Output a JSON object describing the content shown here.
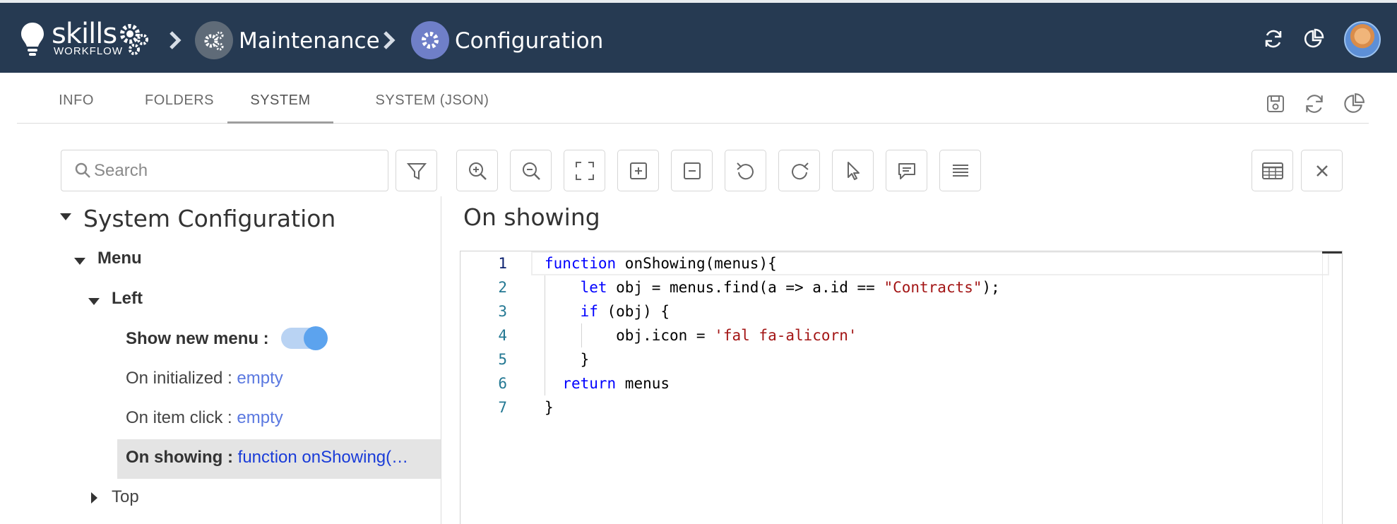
{
  "header": {
    "logo_text": "skills",
    "logo_subtext": "WORKFLOW",
    "breadcrumb": [
      {
        "label": "Maintenance",
        "icon": "gears-icon",
        "color": "#5f6b78"
      },
      {
        "label": "Configuration",
        "icon": "gear-icon",
        "color": "#6f7fc8"
      }
    ],
    "actions": [
      "refresh-icon",
      "pie-chart-icon"
    ],
    "background": "#263a52"
  },
  "tabs": [
    {
      "label": "INFO",
      "active": false
    },
    {
      "label": "FOLDERS",
      "active": false
    },
    {
      "label": "SYSTEM",
      "active": true
    },
    {
      "label": "SYSTEM (JSON)",
      "active": false
    }
  ],
  "tab_tools": [
    "save-icon",
    "refresh-icon",
    "pie-chart-icon"
  ],
  "search": {
    "placeholder": "Search",
    "value": ""
  },
  "toolbar": [
    "filter-icon",
    "zoom-in-icon",
    "zoom-out-icon",
    "fit-screen-icon",
    "expand-icon",
    "collapse-icon",
    "undo-icon",
    "redo-icon",
    "pointer-icon",
    "comment-icon",
    "list-icon",
    "table-icon",
    "close-icon"
  ],
  "tree": {
    "root": "System Configuration",
    "menu": "Menu",
    "left": "Left",
    "props": [
      {
        "label": "Show new menu :",
        "toggle": true
      },
      {
        "label": "On initialized :",
        "value": "empty"
      },
      {
        "label": "On item click :",
        "value": "empty"
      },
      {
        "label": "On showing :",
        "value": "function onShowing(…",
        "selected": true
      }
    ],
    "top": "Top"
  },
  "editor": {
    "title": "On showing",
    "line_numbers": [
      "1",
      "2",
      "3",
      "4",
      "5",
      "6",
      "7"
    ],
    "lines": [
      [
        {
          "t": "function",
          "c": "kw"
        },
        {
          "t": " onShowing(menus){",
          "c": ""
        }
      ],
      [
        {
          "t": "    ",
          "c": ""
        },
        {
          "t": "let",
          "c": "kw"
        },
        {
          "t": " obj = menus.find(a => a.id == ",
          "c": ""
        },
        {
          "t": "\"Contracts\"",
          "c": "str"
        },
        {
          "t": ");",
          "c": ""
        }
      ],
      [
        {
          "t": "    ",
          "c": ""
        },
        {
          "t": "if",
          "c": "kw"
        },
        {
          "t": " (obj) {",
          "c": ""
        }
      ],
      [
        {
          "t": "        obj.icon = ",
          "c": ""
        },
        {
          "t": "'fal fa-alicorn'",
          "c": "str"
        }
      ],
      [
        {
          "t": "    }",
          "c": ""
        }
      ],
      [
        {
          "t": "  ",
          "c": ""
        },
        {
          "t": "return",
          "c": "kw"
        },
        {
          "t": " menus",
          "c": ""
        }
      ],
      [
        {
          "t": "}",
          "c": ""
        }
      ]
    ]
  }
}
